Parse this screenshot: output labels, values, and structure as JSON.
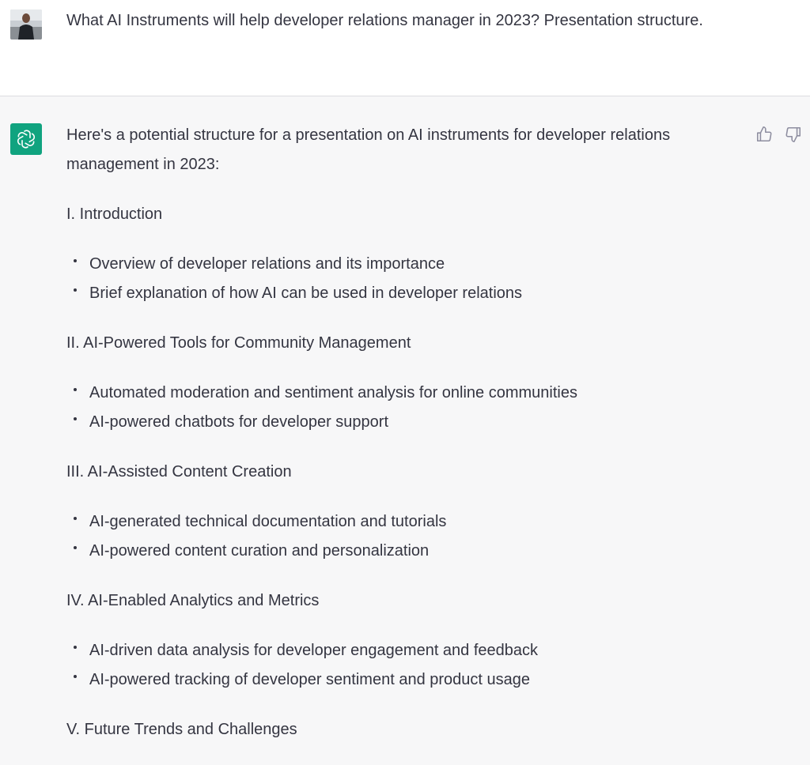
{
  "user": {
    "message": "What AI Instruments will help developer relations manager in 2023? Presentation structure."
  },
  "assistant": {
    "intro": "Here's a potential structure for a presentation on AI instruments for developer relations management in 2023:",
    "sections": [
      {
        "title": "I. Introduction",
        "bullets": [
          "Overview of developer relations and its importance",
          "Brief explanation of how AI can be used in developer relations"
        ]
      },
      {
        "title": "II. AI-Powered Tools for Community Management",
        "bullets": [
          "Automated moderation and sentiment analysis for online communities",
          "AI-powered chatbots for developer support"
        ]
      },
      {
        "title": "III. AI-Assisted Content Creation",
        "bullets": [
          "AI-generated technical documentation and tutorials",
          "AI-powered content curation and personalization"
        ]
      },
      {
        "title": "IV. AI-Enabled Analytics and Metrics",
        "bullets": [
          "AI-driven data analysis for developer engagement and feedback",
          "AI-powered tracking of developer sentiment and product usage"
        ]
      },
      {
        "title": "V. Future Trends and Challenges",
        "bullets": []
      }
    ]
  },
  "icons": {
    "avatar": "user-avatar",
    "assistant": "openai-logo-icon",
    "like": "thumbs-up-icon",
    "dislike": "thumbs-down-icon"
  },
  "colors": {
    "accent": "#10a37f",
    "user_bg": "#ffffff",
    "assistant_bg": "#f7f7f8",
    "text": "#343541"
  }
}
